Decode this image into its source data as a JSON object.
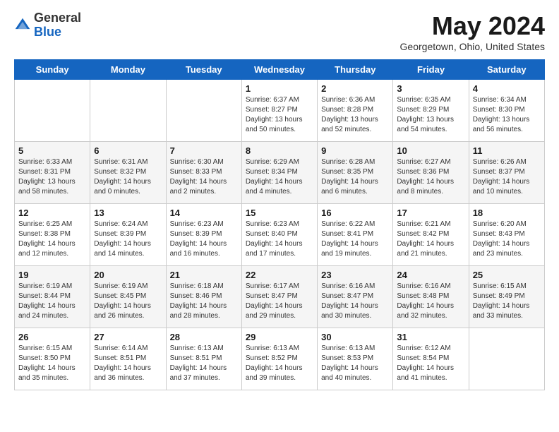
{
  "logo": {
    "general": "General",
    "blue": "Blue"
  },
  "title": "May 2024",
  "subtitle": "Georgetown, Ohio, United States",
  "days_of_week": [
    "Sunday",
    "Monday",
    "Tuesday",
    "Wednesday",
    "Thursday",
    "Friday",
    "Saturday"
  ],
  "weeks": [
    [
      {
        "day": "",
        "info": ""
      },
      {
        "day": "",
        "info": ""
      },
      {
        "day": "",
        "info": ""
      },
      {
        "day": "1",
        "info": "Sunrise: 6:37 AM\nSunset: 8:27 PM\nDaylight: 13 hours\nand 50 minutes."
      },
      {
        "day": "2",
        "info": "Sunrise: 6:36 AM\nSunset: 8:28 PM\nDaylight: 13 hours\nand 52 minutes."
      },
      {
        "day": "3",
        "info": "Sunrise: 6:35 AM\nSunset: 8:29 PM\nDaylight: 13 hours\nand 54 minutes."
      },
      {
        "day": "4",
        "info": "Sunrise: 6:34 AM\nSunset: 8:30 PM\nDaylight: 13 hours\nand 56 minutes."
      }
    ],
    [
      {
        "day": "5",
        "info": "Sunrise: 6:33 AM\nSunset: 8:31 PM\nDaylight: 13 hours\nand 58 minutes."
      },
      {
        "day": "6",
        "info": "Sunrise: 6:31 AM\nSunset: 8:32 PM\nDaylight: 14 hours\nand 0 minutes."
      },
      {
        "day": "7",
        "info": "Sunrise: 6:30 AM\nSunset: 8:33 PM\nDaylight: 14 hours\nand 2 minutes."
      },
      {
        "day": "8",
        "info": "Sunrise: 6:29 AM\nSunset: 8:34 PM\nDaylight: 14 hours\nand 4 minutes."
      },
      {
        "day": "9",
        "info": "Sunrise: 6:28 AM\nSunset: 8:35 PM\nDaylight: 14 hours\nand 6 minutes."
      },
      {
        "day": "10",
        "info": "Sunrise: 6:27 AM\nSunset: 8:36 PM\nDaylight: 14 hours\nand 8 minutes."
      },
      {
        "day": "11",
        "info": "Sunrise: 6:26 AM\nSunset: 8:37 PM\nDaylight: 14 hours\nand 10 minutes."
      }
    ],
    [
      {
        "day": "12",
        "info": "Sunrise: 6:25 AM\nSunset: 8:38 PM\nDaylight: 14 hours\nand 12 minutes."
      },
      {
        "day": "13",
        "info": "Sunrise: 6:24 AM\nSunset: 8:39 PM\nDaylight: 14 hours\nand 14 minutes."
      },
      {
        "day": "14",
        "info": "Sunrise: 6:23 AM\nSunset: 8:39 PM\nDaylight: 14 hours\nand 16 minutes."
      },
      {
        "day": "15",
        "info": "Sunrise: 6:23 AM\nSunset: 8:40 PM\nDaylight: 14 hours\nand 17 minutes."
      },
      {
        "day": "16",
        "info": "Sunrise: 6:22 AM\nSunset: 8:41 PM\nDaylight: 14 hours\nand 19 minutes."
      },
      {
        "day": "17",
        "info": "Sunrise: 6:21 AM\nSunset: 8:42 PM\nDaylight: 14 hours\nand 21 minutes."
      },
      {
        "day": "18",
        "info": "Sunrise: 6:20 AM\nSunset: 8:43 PM\nDaylight: 14 hours\nand 23 minutes."
      }
    ],
    [
      {
        "day": "19",
        "info": "Sunrise: 6:19 AM\nSunset: 8:44 PM\nDaylight: 14 hours\nand 24 minutes."
      },
      {
        "day": "20",
        "info": "Sunrise: 6:19 AM\nSunset: 8:45 PM\nDaylight: 14 hours\nand 26 minutes."
      },
      {
        "day": "21",
        "info": "Sunrise: 6:18 AM\nSunset: 8:46 PM\nDaylight: 14 hours\nand 28 minutes."
      },
      {
        "day": "22",
        "info": "Sunrise: 6:17 AM\nSunset: 8:47 PM\nDaylight: 14 hours\nand 29 minutes."
      },
      {
        "day": "23",
        "info": "Sunrise: 6:16 AM\nSunset: 8:47 PM\nDaylight: 14 hours\nand 30 minutes."
      },
      {
        "day": "24",
        "info": "Sunrise: 6:16 AM\nSunset: 8:48 PM\nDaylight: 14 hours\nand 32 minutes."
      },
      {
        "day": "25",
        "info": "Sunrise: 6:15 AM\nSunset: 8:49 PM\nDaylight: 14 hours\nand 33 minutes."
      }
    ],
    [
      {
        "day": "26",
        "info": "Sunrise: 6:15 AM\nSunset: 8:50 PM\nDaylight: 14 hours\nand 35 minutes."
      },
      {
        "day": "27",
        "info": "Sunrise: 6:14 AM\nSunset: 8:51 PM\nDaylight: 14 hours\nand 36 minutes."
      },
      {
        "day": "28",
        "info": "Sunrise: 6:13 AM\nSunset: 8:51 PM\nDaylight: 14 hours\nand 37 minutes."
      },
      {
        "day": "29",
        "info": "Sunrise: 6:13 AM\nSunset: 8:52 PM\nDaylight: 14 hours\nand 39 minutes."
      },
      {
        "day": "30",
        "info": "Sunrise: 6:13 AM\nSunset: 8:53 PM\nDaylight: 14 hours\nand 40 minutes."
      },
      {
        "day": "31",
        "info": "Sunrise: 6:12 AM\nSunset: 8:54 PM\nDaylight: 14 hours\nand 41 minutes."
      },
      {
        "day": "",
        "info": ""
      }
    ]
  ]
}
